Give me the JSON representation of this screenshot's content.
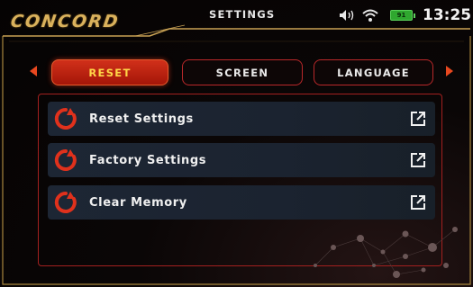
{
  "header": {
    "logo": "CONCORD",
    "title": "SETTINGS",
    "battery_level": "91",
    "time": "13:25"
  },
  "icons": {
    "volume": "volume-icon",
    "wifi": "wifi-icon",
    "battery": "battery-icon",
    "reset": "reset-icon",
    "external": "external-link-icon"
  },
  "tabs": [
    {
      "label": "RESET",
      "active": true
    },
    {
      "label": "SCREEN",
      "active": false
    },
    {
      "label": "LANGUAGE",
      "active": false
    }
  ],
  "items": [
    {
      "label": "Reset Settings"
    },
    {
      "label": "Factory Settings"
    },
    {
      "label": "Clear Memory"
    }
  ],
  "colors": {
    "accent": "#d1301a",
    "gold": "#d9b15c",
    "tab_active_text": "#ffd648",
    "battery": "#2fa82f"
  }
}
